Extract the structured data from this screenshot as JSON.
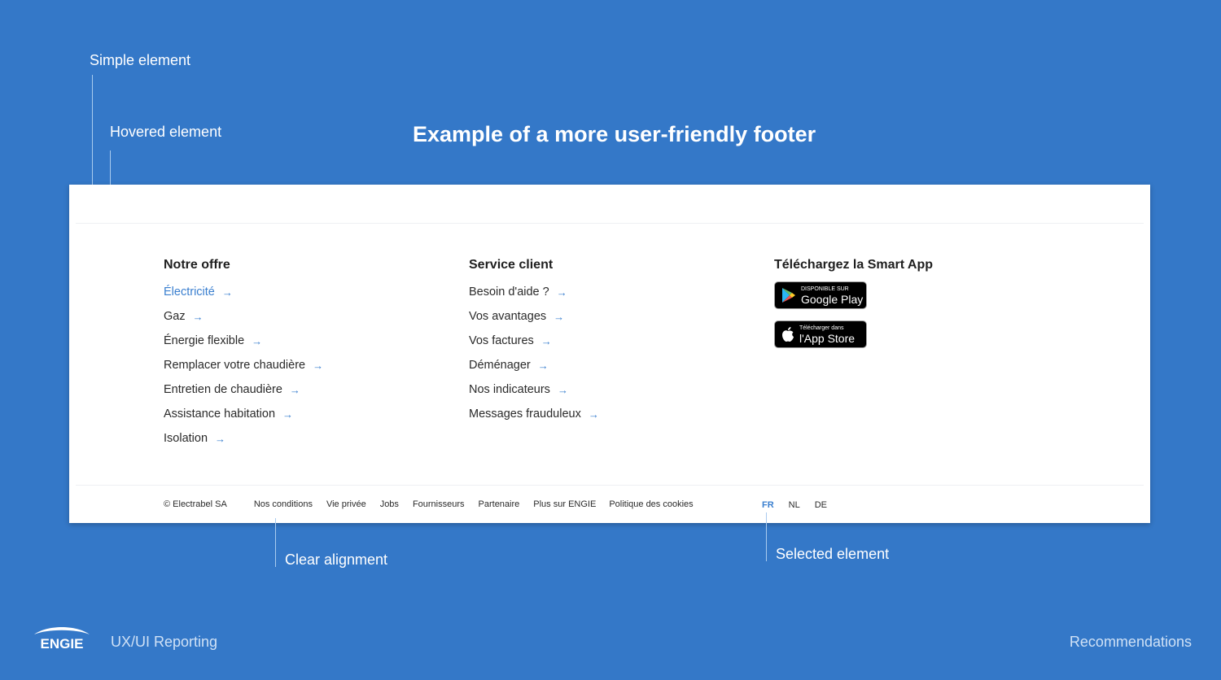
{
  "annotations": {
    "simple": "Simple element",
    "hovered": "Hovered element",
    "alignment": "Clear alignment",
    "selected": "Selected element"
  },
  "title": "Example of a more user-friendly footer",
  "footer": {
    "offer": {
      "heading": "Notre offre",
      "links": [
        "Électricité",
        "Gaz",
        "Énergie flexible",
        "Remplacer votre chaudière",
        "Entretien de chaudière",
        "Assistance habitation",
        "Isolation"
      ]
    },
    "service": {
      "heading": "Service client",
      "links": [
        "Besoin d'aide ?",
        "Vos avantages",
        "Vos factures",
        "Déménager",
        "Nos indicateurs",
        "Messages frauduleux"
      ]
    },
    "app": {
      "heading": "Téléchargez la Smart App",
      "google_small": "DISPONIBLE SUR",
      "google_big": "Google Play",
      "apple_small": "Télécharger dans",
      "apple_big": "l'App Store"
    },
    "legal": {
      "copyright": "© Electrabel SA",
      "links": [
        "Nos conditions",
        "Vie privée",
        "Jobs",
        "Fournisseurs",
        "Partenaire",
        "Plus sur ENGIE",
        "Politique des cookies"
      ]
    },
    "languages": [
      "FR",
      "NL",
      "DE"
    ],
    "selected_language": "FR",
    "arrow_icon": "arrow-right-icon"
  },
  "brand": {
    "logo": "ENGIE",
    "report": "UX/UI Reporting",
    "section": "Recommendations"
  },
  "colors": {
    "background": "#3478c8",
    "accent": "#3a7fcf"
  }
}
